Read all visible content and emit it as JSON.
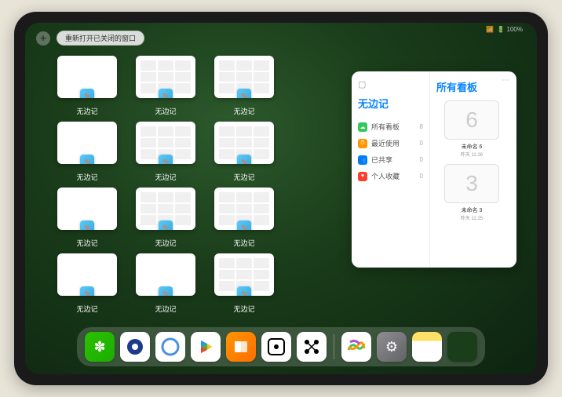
{
  "status_bar": {
    "signal": "📶",
    "battery": "🔋 100%"
  },
  "top": {
    "plus": "+",
    "reopen_label": "重新打开已关闭的窗口"
  },
  "app_windows": {
    "label": "无边记",
    "grid": [
      {
        "visible": true,
        "has_content": false
      },
      {
        "visible": true,
        "has_content": true
      },
      {
        "visible": true,
        "has_content": true
      },
      {
        "visible": false
      },
      {
        "visible": true,
        "has_content": false
      },
      {
        "visible": true,
        "has_content": true
      },
      {
        "visible": true,
        "has_content": true
      },
      {
        "visible": false
      },
      {
        "visible": true,
        "has_content": false
      },
      {
        "visible": true,
        "has_content": true
      },
      {
        "visible": true,
        "has_content": true
      },
      {
        "visible": false
      },
      {
        "visible": true,
        "has_content": false
      },
      {
        "visible": true,
        "has_content": false
      },
      {
        "visible": true,
        "has_content": true
      },
      {
        "visible": false
      }
    ]
  },
  "side_panel": {
    "left": {
      "title": "无边记",
      "items": [
        {
          "icon": "☁",
          "cls": "ic-cloud",
          "label": "所有看板",
          "count": "8"
        },
        {
          "icon": "⏱",
          "cls": "ic-recent",
          "label": "最近使用",
          "count": "0"
        },
        {
          "icon": "👥",
          "cls": "ic-shared",
          "label": "已共享",
          "count": "0"
        },
        {
          "icon": "♥",
          "cls": "ic-fav",
          "label": "个人收藏",
          "count": "0"
        }
      ]
    },
    "right": {
      "title": "所有看板",
      "boards": [
        {
          "glyph": "6",
          "name": "未命名 6",
          "sub": "昨天 11:26"
        },
        {
          "glyph": "3",
          "name": "未命名 3",
          "sub": "昨天 11:25"
        }
      ]
    }
  },
  "dock": {
    "icons": [
      {
        "name": "wechat",
        "cls": "di-wechat",
        "glyph": "✽"
      },
      {
        "name": "qq-browser",
        "cls": "di-blue1",
        "glyph": ""
      },
      {
        "name": "quark",
        "cls": "di-blue2",
        "glyph": ""
      },
      {
        "name": "play",
        "cls": "di-play",
        "glyph": ""
      },
      {
        "name": "books",
        "cls": "di-books",
        "glyph": ""
      },
      {
        "name": "dice",
        "cls": "di-dice",
        "glyph": ""
      },
      {
        "name": "connect",
        "cls": "di-connect",
        "glyph": ""
      },
      {
        "name": "separator"
      },
      {
        "name": "freeform",
        "cls": "di-freeform",
        "glyph": ""
      },
      {
        "name": "settings",
        "cls": "di-settings",
        "glyph": "⚙"
      },
      {
        "name": "notes",
        "cls": "di-notes",
        "glyph": ""
      },
      {
        "name": "app-library",
        "cls": "di-multi",
        "glyph": ""
      }
    ]
  }
}
